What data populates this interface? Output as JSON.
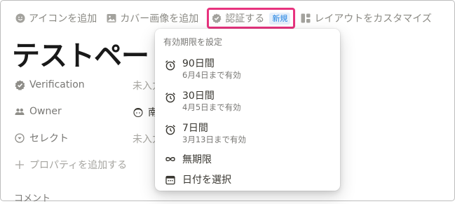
{
  "toolbar": {
    "add_icon": "アイコンを追加",
    "add_cover": "カバー画像を追加",
    "verify": "認証する",
    "verify_badge": "新規",
    "customize_layout": "レイアウトをカスタマイズ"
  },
  "page": {
    "title": "テストペー"
  },
  "properties": [
    {
      "icon": "verified-check-icon",
      "name": "Verification",
      "value": "未入力"
    },
    {
      "icon": "people-icon",
      "name": "Owner",
      "value": "南"
    },
    {
      "icon": "select-chevron-icon",
      "name": "セレクト",
      "value": "未入力"
    }
  ],
  "add_property": "プロパティを追加する",
  "comments_label": "コメント",
  "verify_menu": {
    "header": "有効期限を設定",
    "options": [
      {
        "icon": "alarm-clock-icon",
        "label": "90日間",
        "sub": "6月4日まで有効"
      },
      {
        "icon": "alarm-clock-icon",
        "label": "30日間",
        "sub": "4月5日まで有効"
      },
      {
        "icon": "alarm-clock-icon",
        "label": "7日間",
        "sub": "3月13日まで有効"
      },
      {
        "icon": "infinity-icon",
        "label": "無期限"
      },
      {
        "icon": "calendar-icon",
        "label": "日付を選択"
      }
    ]
  },
  "colors": {
    "highlight": "#e8337e",
    "badge_text": "#2383e2",
    "badge_bg": "#e6f0fb"
  }
}
